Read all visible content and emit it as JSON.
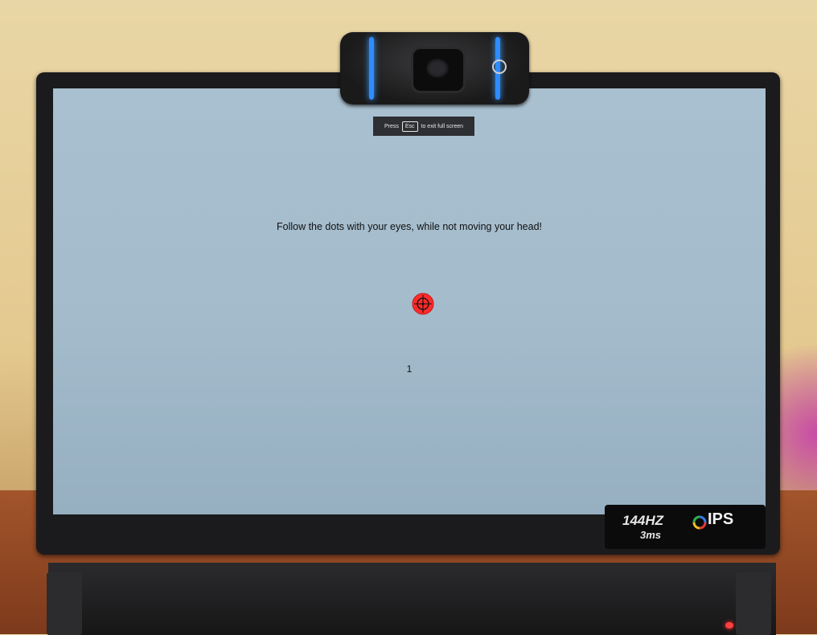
{
  "fullscreen_notice": {
    "press": "Press",
    "key": "Esc",
    "suffix": "to exit full screen"
  },
  "calibration": {
    "instruction": "Follow the dots with your eyes, while not moving your head!",
    "point_number": "1",
    "target_color": "#ff2a2a",
    "target_icon": "crosshair-icon"
  },
  "monitor_badge": {
    "refresh_rate": "144HZ",
    "response_time": "3ms",
    "panel": "IPS"
  }
}
